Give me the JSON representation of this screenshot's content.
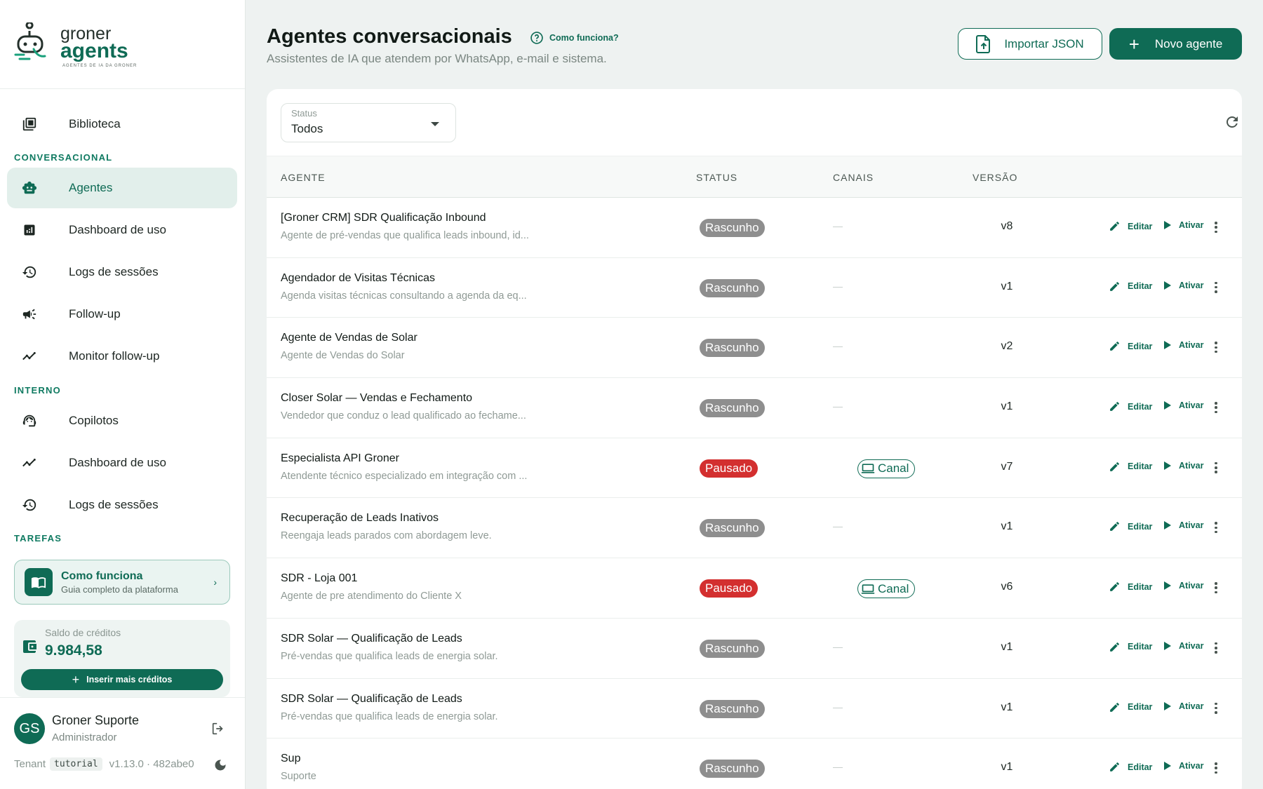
{
  "brand": {
    "name_top": "groner",
    "name_bottom": "agents",
    "tagline": "AGENTES DE IA DA GRONER",
    "color": "#0f6b55"
  },
  "sidebar": {
    "library": "Biblioteca",
    "section_conversational": "CONVERSACIONAL",
    "conversational_items": [
      {
        "label": "Agentes",
        "icon": "robot-icon",
        "active": true
      },
      {
        "label": "Dashboard de uso",
        "icon": "bar-chart-icon"
      },
      {
        "label": "Logs de sessões",
        "icon": "history-icon"
      },
      {
        "label": "Follow-up",
        "icon": "megaphone-icon"
      },
      {
        "label": "Monitor follow-up",
        "icon": "trend-icon"
      }
    ],
    "section_internal": "INTERNO",
    "internal_items": [
      {
        "label": "Copilotos",
        "icon": "support-agent-icon"
      },
      {
        "label": "Dashboard de uso",
        "icon": "trend-icon"
      },
      {
        "label": "Logs de sessões",
        "icon": "history-icon"
      }
    ],
    "section_tasks": "TAREFAS",
    "help_card": {
      "title": "Como funciona",
      "subtitle": "Guia completo da plataforma"
    },
    "credits": {
      "label": "Saldo de créditos",
      "value": "9.984,58",
      "button": "Inserir mais créditos"
    },
    "user": {
      "initials": "GS",
      "name": "Groner Suporte",
      "role": "Administrador"
    },
    "footer": {
      "tenant_label": "Tenant",
      "tenant": "tutorial",
      "version": "v1.13.0 · 482abe0"
    }
  },
  "header": {
    "title": "Agentes conversacionais",
    "howto": "Como funciona?",
    "subtitle": "Assistentes de IA que atendem por WhatsApp, e-mail e sistema.",
    "import_button": "Importar JSON",
    "new_button": "Novo agente"
  },
  "filter": {
    "label": "Status",
    "value": "Todos"
  },
  "table": {
    "columns": {
      "agent": "AGENTE",
      "status": "STATUS",
      "channels": "CANAIS",
      "version": "VERSÃO"
    },
    "edit_label": "Editar",
    "activate_label": "Ativar",
    "rows": [
      {
        "name": "[Groner CRM] SDR Qualificação Inbound",
        "desc": "Agente de pré-vendas que qualifica leads inbound, id...",
        "status": "Rascunho",
        "status_type": "draft",
        "channel": "",
        "version": "v8"
      },
      {
        "name": "Agendador de Visitas Técnicas",
        "desc": "Agenda visitas técnicas consultando a agenda da eq...",
        "status": "Rascunho",
        "status_type": "draft",
        "channel": "",
        "version": "v1"
      },
      {
        "name": "Agente de Vendas de Solar",
        "desc": "Agente de Vendas do Solar",
        "status": "Rascunho",
        "status_type": "draft",
        "channel": "",
        "version": "v2"
      },
      {
        "name": "Closer Solar — Vendas e Fechamento",
        "desc": "Vendedor que conduz o lead qualificado ao fechame...",
        "status": "Rascunho",
        "status_type": "draft",
        "channel": "",
        "version": "v1"
      },
      {
        "name": "Especialista API Groner",
        "desc": "Atendente técnico especializado em integração com ...",
        "status": "Pausado",
        "status_type": "paused",
        "channel": "Canal",
        "version": "v7"
      },
      {
        "name": "Recuperação de Leads Inativos",
        "desc": "Reengaja leads parados com abordagem leve.",
        "status": "Rascunho",
        "status_type": "draft",
        "channel": "",
        "version": "v1"
      },
      {
        "name": "SDR - Loja 001",
        "desc": "Agente de pre atendimento do Cliente X",
        "status": "Pausado",
        "status_type": "paused",
        "channel": "Canal",
        "version": "v6"
      },
      {
        "name": "SDR Solar — Qualificação de Leads",
        "desc": "Pré-vendas que qualifica leads de energia solar.",
        "status": "Rascunho",
        "status_type": "draft",
        "channel": "",
        "version": "v1"
      },
      {
        "name": "SDR Solar — Qualificação de Leads",
        "desc": "Pré-vendas que qualifica leads de energia solar.",
        "status": "Rascunho",
        "status_type": "draft",
        "channel": "",
        "version": "v1"
      },
      {
        "name": "Sup",
        "desc": "Suporte",
        "status": "Rascunho",
        "status_type": "draft",
        "channel": "",
        "version": "v1"
      }
    ]
  }
}
